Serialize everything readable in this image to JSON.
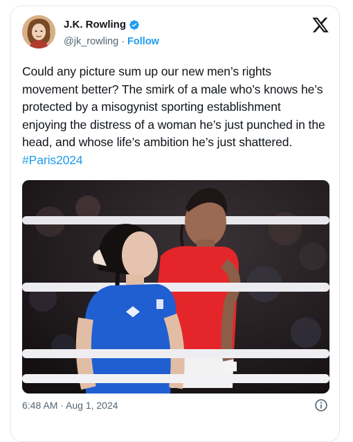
{
  "author": {
    "name": "J.K. Rowling",
    "handle": "@jk_rowling",
    "separator": "·",
    "follow_label": "Follow",
    "verified": true,
    "avatar_icon": "profile-photo"
  },
  "platform_icon": "x-logo",
  "tweet": {
    "text": "Could any picture sum up our new men’s rights movement better? The smirk of a male who’s knows he’s protected by a misogynist sporting establishment enjoying the distress of a woman he’s just punched in the head, and whose life’s ambition he’s just shattered. ",
    "hashtag": "#Paris2024"
  },
  "media": {
    "type": "photo",
    "subject": "two boxers in a ring, one in blue and one in red"
  },
  "footer": {
    "timestamp": "6:48 AM · Aug 1, 2024",
    "info_icon": "info-icon"
  },
  "colors": {
    "accent": "#1d9bf0",
    "text": "#0f1419",
    "muted": "#536471",
    "blue_kit": "#1f5fd1",
    "red_kit": "#e4262b"
  }
}
